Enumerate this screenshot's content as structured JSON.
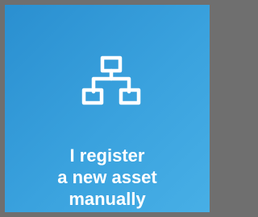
{
  "tile": {
    "label_lines": [
      "I register",
      "a new asset",
      "manually"
    ],
    "icon": "hierarchy-network-icon",
    "colors": {
      "background_start": "#2a8fd0",
      "background_end": "#47afe6",
      "border": "#6f6f6f",
      "foreground": "#ffffff"
    }
  }
}
